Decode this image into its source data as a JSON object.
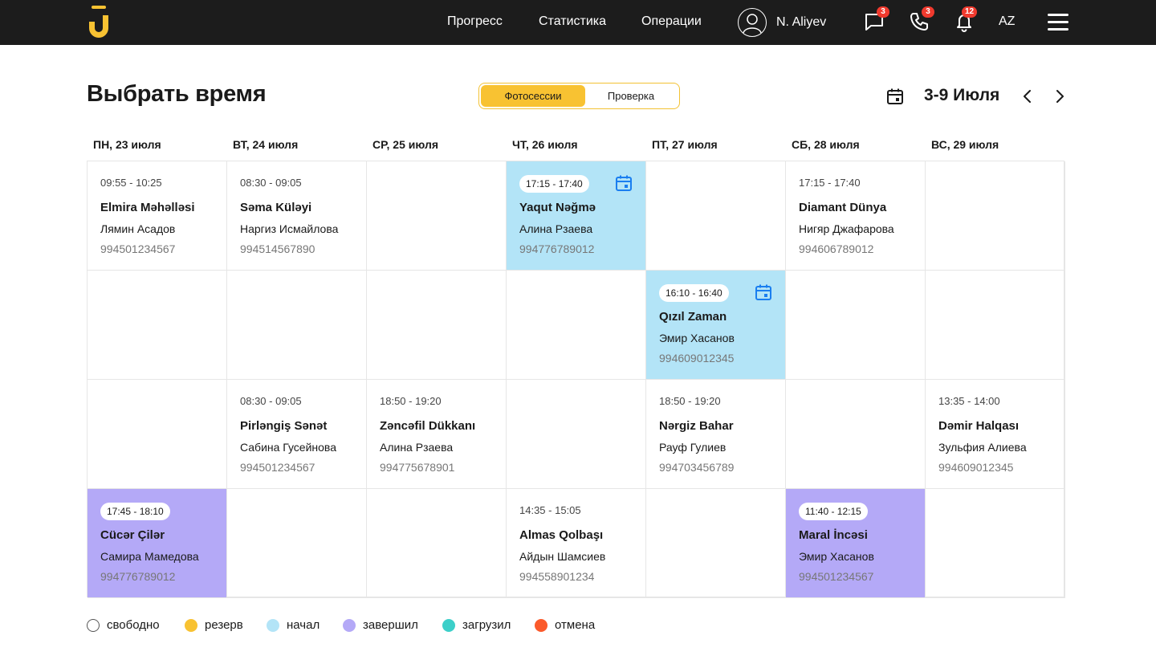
{
  "nav": {
    "links": [
      "Прогресс",
      "Статистика",
      "Операции"
    ],
    "user_name": "N. Aliyev",
    "messages_count": "3",
    "calls_count": "3",
    "notifications_count": "12",
    "language": "AZ"
  },
  "header": {
    "title": "Выбрать время",
    "toggle": [
      "Фотосессии",
      "Проверка"
    ],
    "toggle_active": 0,
    "range": "3-9 Июля"
  },
  "days": [
    "ПН, 23 июля",
    "ВТ, 24 июля",
    "СР, 25 июля",
    "ЧТ, 26 июля",
    "ПТ, 27 июля",
    "СБ, 28 июля",
    "ВС, 29 июля"
  ],
  "rows": [
    [
      {
        "time": "09:55 - 10:25",
        "place": "Elmira Məhəlləsi",
        "person": "Лямин Асадов",
        "phone": "994501234567",
        "status": "free"
      },
      {
        "time": "08:30 - 09:05",
        "place": "Səma Küləyi",
        "person": "Наргиз Исмайлова",
        "phone": "994514567890",
        "status": "free"
      },
      null,
      {
        "time": "17:15 - 17:40",
        "place": "Yaqut Nəğmə",
        "person": "Алина Рзаева",
        "phone": "994776789012",
        "status": "started"
      },
      null,
      {
        "time": "17:15 - 17:40",
        "place": "Diamant Dünya",
        "person": "Нигяр Джафарова",
        "phone": "994606789012",
        "status": "free"
      },
      null
    ],
    [
      null,
      null,
      null,
      null,
      {
        "time": "16:10 - 16:40",
        "place": "Qızıl Zaman",
        "person": "Эмир Хасанов",
        "phone": "994609012345",
        "status": "started"
      },
      null,
      null
    ],
    [
      null,
      {
        "time": "08:30 - 09:05",
        "place": "Pirləngiş Sənət",
        "person": "Сабина Гусейнова",
        "phone": "994501234567",
        "status": "free"
      },
      {
        "time": "18:50 - 19:20",
        "place": "Zəncəfil Dükkanı",
        "person": "Алина Рзаева",
        "phone": "994775678901",
        "status": "free"
      },
      null,
      {
        "time": "18:50 - 19:20",
        "place": "Nərgiz Bahar",
        "person": "Рауф Гулиев",
        "phone": "994703456789",
        "status": "free"
      },
      null,
      {
        "time": "13:35 - 14:00",
        "place": "Dəmir Halqası",
        "person": "Зульфия Алиева",
        "phone": "994609012345",
        "status": "free"
      }
    ],
    [
      {
        "time": "17:45 - 18:10",
        "place": "Cücər Çilər",
        "person": "Самира Мамедова",
        "phone": "994776789012",
        "status": "done"
      },
      null,
      null,
      {
        "time": "14:35 - 15:05",
        "place": "Almas Qolbaşı",
        "person": "Айдын Шамсиев",
        "phone": "994558901234",
        "status": "free"
      },
      null,
      {
        "time": "11:40 - 12:15",
        "place": "Maral İncəsi",
        "person": "Эмир Хасанов",
        "phone": "994501234567",
        "status": "done"
      },
      null
    ]
  ],
  "legend": [
    {
      "label": "свободно",
      "color": "#ffffff",
      "border": "#555555"
    },
    {
      "label": "резерв",
      "color": "#f8c232"
    },
    {
      "label": "начал",
      "color": "#b3e4f7"
    },
    {
      "label": "завершил",
      "color": "#b4a9f7"
    },
    {
      "label": "загрузил",
      "color": "#3ccfc9"
    },
    {
      "label": "отмена",
      "color": "#fb5a2b"
    }
  ],
  "icons": {
    "logo": "brand-logo",
    "avatar": "user-avatar-icon",
    "messages": "chat-icon",
    "calls": "phone-icon",
    "notifications": "bell-icon",
    "menu": "hamburger-menu-icon",
    "calendar": "calendar-icon",
    "prev": "chevron-left-icon",
    "next": "chevron-right-icon"
  }
}
